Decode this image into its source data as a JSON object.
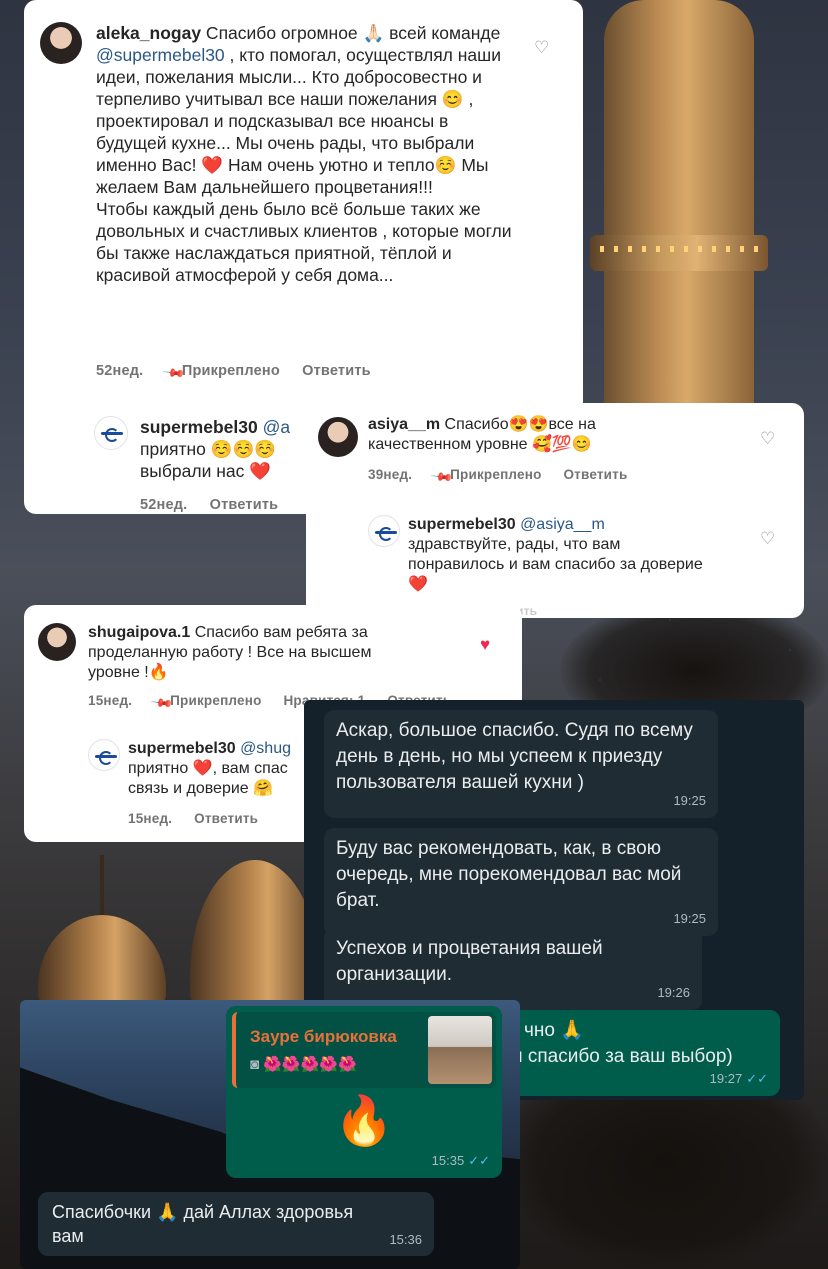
{
  "comments": {
    "c1": {
      "username": "aleka_nogay",
      "text_before_mention": " Спасибо огромное 🙏🏻 всей команде ",
      "mention": "@supermebel30",
      "text_after_mention": " , кто помогал, осуществлял наши идеи, пожелания мысли... Кто добросовестно и терпеливо учитывал все наши пожелания 😊 , проектировал  и подсказывал все нюансы в будущей кухне... Мы очень рады, что выбрали именно Вас! ❤️ Нам очень уютно и тепло☺️ Мы желаем Вам дальнейшего процветания!!!",
      "text_para2": "Чтобы каждый день было всё больше таких же довольных и счастливых клиентов , которые могли бы также наслаждаться приятной, тёплой и красивой атмосферой у себя дома...",
      "time": "52нед.",
      "pinned": "Прикреплено",
      "reply": "Ответить"
    },
    "r1": {
      "username": "supermebel30",
      "mention": "@a",
      "line2": "приятно ☺️☺️☺️",
      "line3": "выбрали нас ❤️",
      "time": "52нед.",
      "reply": "Ответить"
    },
    "c2": {
      "username": "asiya__m",
      "line1": " Спасибо😍😍все на",
      "line2": "качественном уровне 🥰💯😊",
      "time": "39нед.",
      "pinned": "Прикреплено",
      "reply": "Ответить"
    },
    "r2": {
      "username": "supermebel30",
      "mention": "@asiya__m",
      "line2": "здравствуйте, рады, что вам",
      "line3": "понравилось и вам спасибо за доверие",
      "line4": "❤️",
      "peek": "ить"
    },
    "c3": {
      "username": "shugaipova.1",
      "line1": " Спасибо вам ребята за",
      "line2": "проделанную работу ! Все на высшем",
      "line3": "уровне !🔥",
      "time": "15нед.",
      "pinned": "Прикреплено",
      "likes": "Нравится: 1",
      "reply": "Ответить"
    },
    "r3": {
      "username": "supermebel30",
      "mention": "@shug",
      "line2": "приятно ❤️, вам спас",
      "line3": "связь и доверие 🤗",
      "time": "15нед.",
      "reply": "Ответить"
    }
  },
  "whatsapp_dark": {
    "m1": {
      "text": "Аскар, большое спасибо. Судя по всему день в день, но мы успеем к приезду пользователя вашей кухни )",
      "time": "19:25"
    },
    "m2": {
      "text": "Буду вас рекомендовать, как, в свою очередь, мне порекомендовал вас мой брат.",
      "time": "19:25"
    },
    "m3": {
      "text": "Успехов и процветания вашей организации.",
      "time": "19:26"
    },
    "m4": {
      "line1": "чно 🙏",
      "line2": "и спасибо за ваш выбор)",
      "time": "19:27",
      "ticks": "✓✓"
    }
  },
  "whatsapp_mountain": {
    "quote_name": "Зауре бирюковка",
    "quote_emojis": "🌺🌺🌺🌺🌺",
    "reply_emoji": "🔥",
    "reply_time": "15:35",
    "ticks": "✓✓",
    "incoming_text": "Спасибочки 🙏 дай Аллах здоровья вам",
    "incoming_time": "15:36"
  },
  "colors": {
    "instagram_link": "#2b5887",
    "like_red": "#ed2a4f",
    "wa_outgoing": "#005c4b",
    "wa_incoming": "#202c33",
    "wa_quote_name": "#e8703a"
  }
}
